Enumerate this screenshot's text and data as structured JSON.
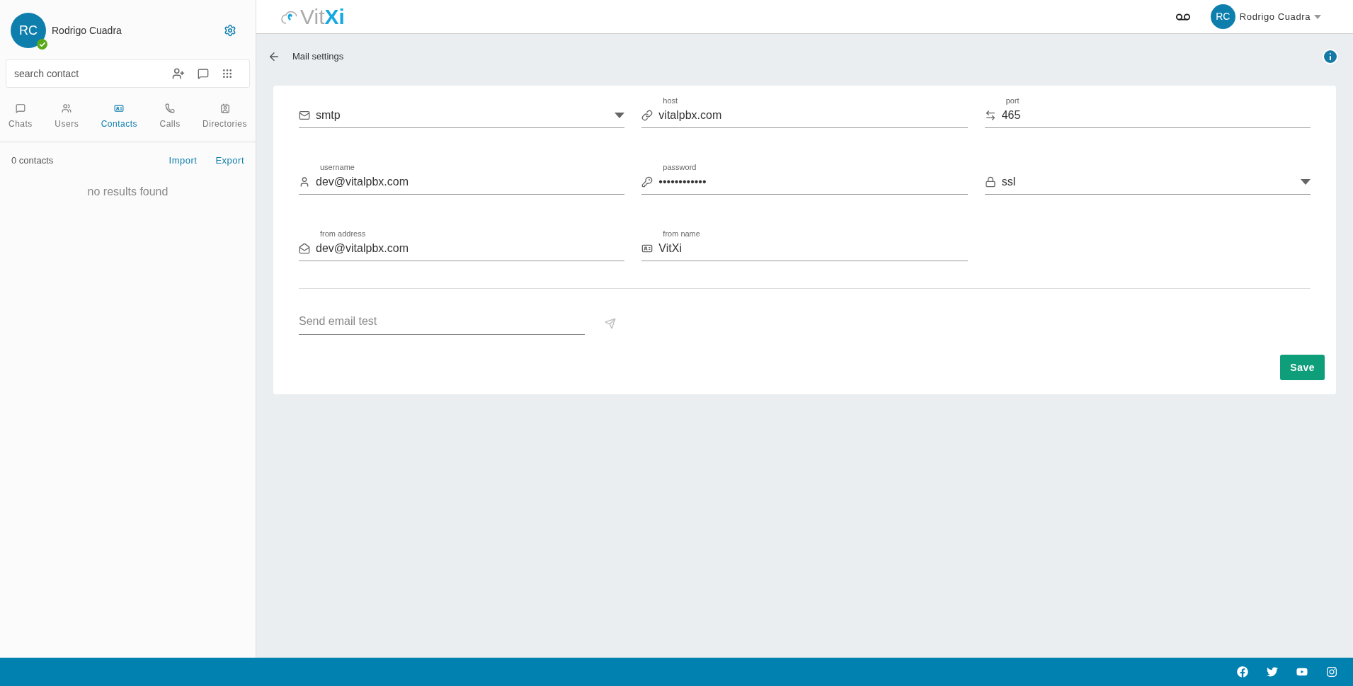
{
  "sidebar": {
    "user": {
      "initials": "RC",
      "name": "Rodrigo Cuadra",
      "online": true
    },
    "search": {
      "placeholder": "search contact"
    },
    "tabs": [
      {
        "label": "Chats",
        "selected": false
      },
      {
        "label": "Users",
        "selected": false
      },
      {
        "label": "Contacts",
        "selected": true
      },
      {
        "label": "Calls",
        "selected": false
      },
      {
        "label": "Directories",
        "selected": false
      }
    ],
    "count": "0 contacts",
    "actions": [
      "Import",
      "Export"
    ],
    "empty": "no results found"
  },
  "header": {
    "logo": [
      {
        "text": "Vit",
        "kind": "plain"
      },
      {
        "text": "Xi",
        "kind": "accent"
      }
    ],
    "user": {
      "initials": "RC",
      "name": "Rodrigo Cuadra"
    }
  },
  "page": {
    "title": "Mail settings"
  },
  "form": {
    "fields": [
      {
        "kind": "select",
        "value": "smtp"
      },
      {
        "kind": "text",
        "label": "host",
        "value": "vitalpbx.com"
      },
      {
        "kind": "text",
        "label": "port",
        "value": "465"
      },
      {
        "kind": "text",
        "label": "username",
        "value": "dev@vitalpbx.com"
      },
      {
        "kind": "password",
        "label": "password",
        "value": "••••••••••••"
      },
      {
        "kind": "select",
        "value": "ssl"
      },
      {
        "kind": "text",
        "label": "from address",
        "value": "dev@vitalpbx.com"
      },
      {
        "kind": "text",
        "label": "from name",
        "value": "VitXi"
      }
    ],
    "test": {
      "placeholder": "Send email test"
    },
    "save": "Save"
  }
}
